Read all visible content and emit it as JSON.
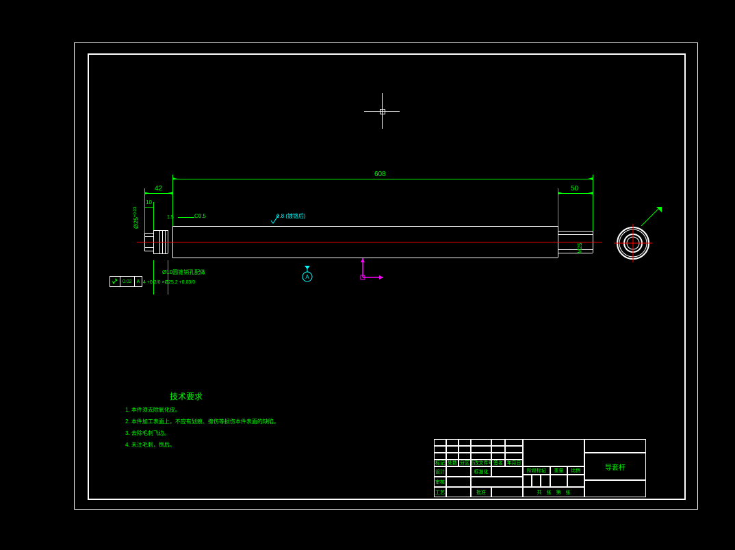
{
  "dimensions": {
    "total_length": "608",
    "left_section": "42",
    "right_section": "50",
    "left_small": "10",
    "chamfer": "C0.5",
    "diameter_main": "Ø25",
    "diameter_main_tol_u": "+0.03",
    "diameter_main_tol_l": "0",
    "thread_right": "M25",
    "pin_hole": "Ø10圆锥销孔配做",
    "groove": "4 +0.2/0 ×Ø25.2 +0.03/0",
    "groove_width": "1.5",
    "surface_note": "0.8 (镀铬后)",
    "runout": "0.02",
    "runout_ref": "A"
  },
  "datum": {
    "a_label": "A",
    "symbol": "⌖"
  },
  "tech_req_title": "技术要求",
  "tech_req": [
    "1. 本件须去除氧化皮。",
    "2. 本件加工表面上，不应有划痕、擦伤等损伤本件表面的缺陷。",
    "3. 去除毛刺飞边。",
    "4. 未注毛刺，倒后。"
  ],
  "title_block": {
    "part_name": "导套杆",
    "row1": [
      "标记",
      "处数",
      "分区",
      "更改文件号",
      "签名",
      "年月日"
    ],
    "row2": [
      "设计",
      "",
      "标准化",
      ""
    ],
    "row3": [
      "审核",
      ""
    ],
    "row4": [
      "工艺",
      "",
      "批准",
      ""
    ],
    "stage": "阶段标记",
    "weight": "重量",
    "scale": "比例",
    "sheet": "共　张　第　张"
  },
  "ucs": {
    "x": "",
    "y": ""
  }
}
